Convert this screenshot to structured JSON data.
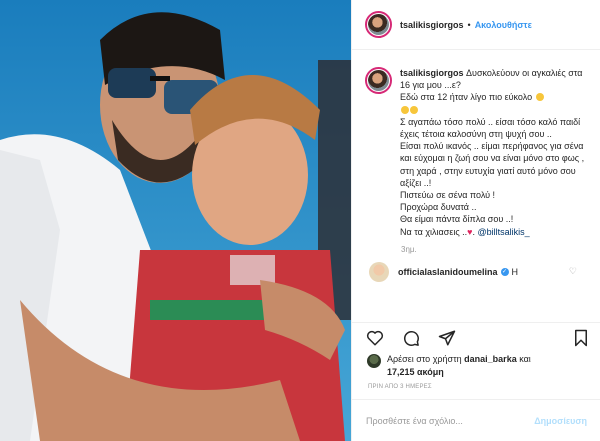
{
  "post": {
    "username": "tsalikisgiorgos",
    "follow_label": "Ακολουθήστε",
    "separator": "•",
    "caption_lines": [
      "Δυσκολεύουν οι αγκαλιές στα 16 για μου ...ε?",
      "Εδώ στα 12 ήταν λίγο πιο εύκολο",
      "Σ αγαπάω τόσο πολύ .. είσαι τόσο καλό παιδί έχεις τέτοια καλοσύνη στη ψυχή σου ..",
      "Είσαι πολύ ικανός .. είμαι περήφανος για σένα και εύχομαι η ζωή σου να είναι μόνο στο φως , στη χαρά , στην ευτυχία γιατί αυτό μόνο σου αξίζει ..!",
      "Πιστεύω σε σένα πολύ !",
      "Προχώρα δυνατά ..",
      "Θα είμαι πάντα δίπλα σου ..!",
      "Να τα χιλιασεις .."
    ],
    "heart_glyph": "♥",
    "mention": "@billtsalikis_",
    "time_ago": "3ημ."
  },
  "comment": {
    "username": "officialaslanidoumelina",
    "text": "Η"
  },
  "likes": {
    "prefix": "Αρέσει στο χρήστη",
    "liker": "danai_barka",
    "conjunction": "και",
    "count": "17,215 ακόμη"
  },
  "timestamp": "ΠΡΙΝ ΑΠΟ 3 ΗΜΕΡΕΣ",
  "comment_bar": {
    "placeholder": "Προσθέστε ένα σχόλιο...",
    "post_label": "Δημοσίευση"
  },
  "icons": [
    "heart-icon",
    "comment-icon",
    "share-icon",
    "bookmark-icon",
    "verified-icon"
  ],
  "colors": {
    "link_blue": "#3897f0",
    "post_button_disabled": "#b2dffc",
    "text": "#262626",
    "muted": "#999999",
    "divider": "#efefef"
  }
}
